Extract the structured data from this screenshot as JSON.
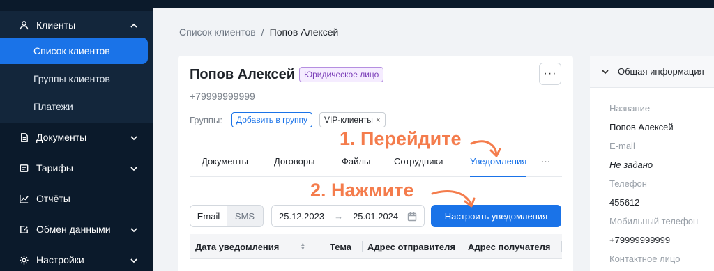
{
  "sidebar": {
    "clients": "Клиенты",
    "submenu": [
      "Список клиентов",
      "Группы клиентов",
      "Платежи"
    ],
    "items": [
      "Документы",
      "Тарифы",
      "Отчёты",
      "Обмен данными",
      "Настройки"
    ]
  },
  "breadcrumb": {
    "parent": "Список клиентов",
    "sep": "/",
    "current": "Попов Алексей"
  },
  "client": {
    "name": "Попов Алексей",
    "badge": "Юридическое лицо",
    "more": "···",
    "phone": "+79999999999",
    "groups_label": "Группы:",
    "add_group": "Добавить в группу",
    "group_tag": "VIP-клиенты",
    "group_tag_close": "×"
  },
  "tabs": [
    "Документы",
    "Договоры",
    "Файлы",
    "Сотрудники",
    "Уведомления",
    "···"
  ],
  "filters": {
    "channel": [
      "Email",
      "SMS"
    ],
    "date_from": "25.12.2023",
    "date_arrow": "→",
    "date_to": "25.01.2024",
    "configure_button": "Настроить уведомления"
  },
  "table": {
    "columns": [
      "Дата уведомления",
      "Тема",
      "Адрес отправителя",
      "Адрес получателя"
    ]
  },
  "info_panel": {
    "title": "Общая информация",
    "fields": [
      {
        "label": "Название",
        "value": "Попов Алексей"
      },
      {
        "label": "E-mail",
        "value": "Не задано"
      },
      {
        "label": "Телефон",
        "value": "455612"
      },
      {
        "label": "Мобильный телефон",
        "value": "+79999999999"
      },
      {
        "label": "Контактное лицо",
        "value": ""
      }
    ]
  },
  "annotations": {
    "step1": "1. Перейдите",
    "step2": "2. Нажмите"
  },
  "colors": {
    "accent": "#1a73e8",
    "sidebar": "#0b1a2b",
    "annotation": "#f47c4c"
  }
}
